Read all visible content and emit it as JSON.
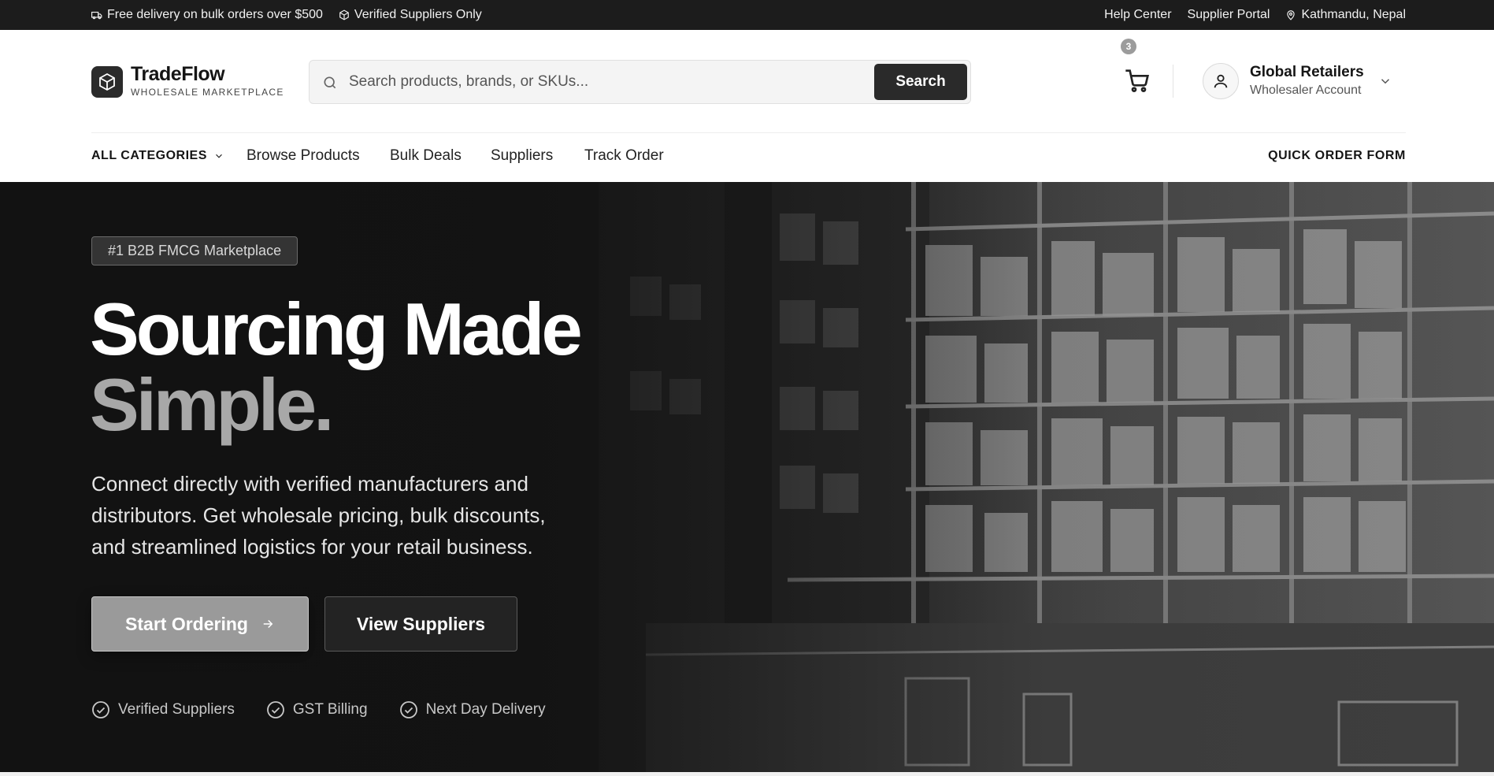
{
  "topbar": {
    "delivery": "Free delivery on bulk orders over $500",
    "verified": "Verified Suppliers Only",
    "help": "Help Center",
    "supplier_portal": "Supplier Portal",
    "location": "Kathmandu, Nepal"
  },
  "brand": {
    "name": "TradeFlow",
    "tagline": "WHOLESALE MARKETPLACE"
  },
  "search": {
    "placeholder": "Search products, brands, or SKUs...",
    "value": "",
    "button": "Search"
  },
  "cart": {
    "count": "3"
  },
  "account": {
    "name": "Global Retailers",
    "type": "Wholesaler Account"
  },
  "nav": {
    "all_categories": "ALL CATEGORIES",
    "links": [
      "Browse Products",
      "Bulk Deals",
      "Suppliers",
      "Track Order"
    ],
    "quick_order": "QUICK ORDER FORM"
  },
  "hero": {
    "badge": "#1 B2B FMCG Marketplace",
    "headline_1": "Sourcing Made",
    "headline_2": "Simple.",
    "lead": "Connect directly with verified manufacturers and distributors. Get wholesale pricing, bulk discounts, and streamlined logistics for your retail business.",
    "cta_primary": "Start Ordering",
    "cta_secondary": "View Suppliers",
    "features": [
      "Verified Suppliers",
      "GST Billing",
      "Next Day Delivery"
    ]
  },
  "icons": {
    "truck": "truck-icon",
    "package": "package-icon",
    "pin": "map-pin-icon",
    "search": "search-icon",
    "cart": "cart-icon",
    "user": "user-icon",
    "chevron": "chevron-down-icon",
    "arrow": "arrow-right-icon",
    "check": "check-circle-icon"
  },
  "colors": {
    "topbar_bg": "#1c1c1c",
    "primary_dark": "#2a2a2a",
    "hero_primary_button": "#9a9a9a",
    "headline_muted": "#a8a8a8"
  }
}
